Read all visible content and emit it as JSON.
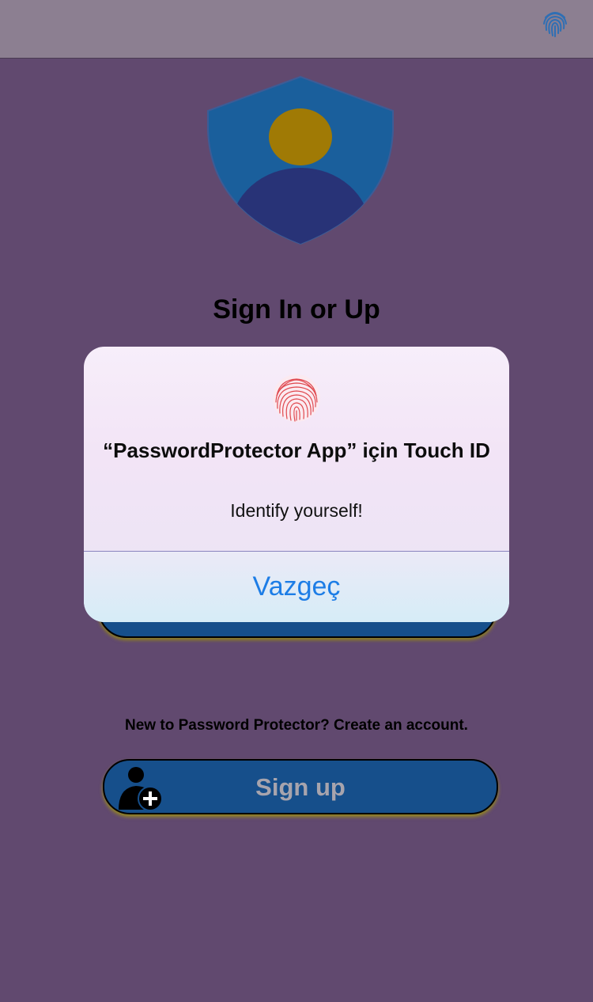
{
  "nav": {
    "right_icon": "fingerprint-icon"
  },
  "logo": {
    "icon": "shield-user-icon"
  },
  "main": {
    "title": "Sign In or Up",
    "signup_prompt": "New to Password Protector? Create an account.",
    "signup_button": {
      "label": "Sign up",
      "icon": "add-user-icon"
    }
  },
  "alert": {
    "icon": "fingerprint-icon",
    "title": "“PasswordProtector App” için Touch ID",
    "message": "Identify yourself!",
    "cancel_label": "Vazgeç"
  },
  "colors": {
    "background": "#61496f",
    "button_fill": "#164f8b",
    "accent": "#1d7de6"
  }
}
